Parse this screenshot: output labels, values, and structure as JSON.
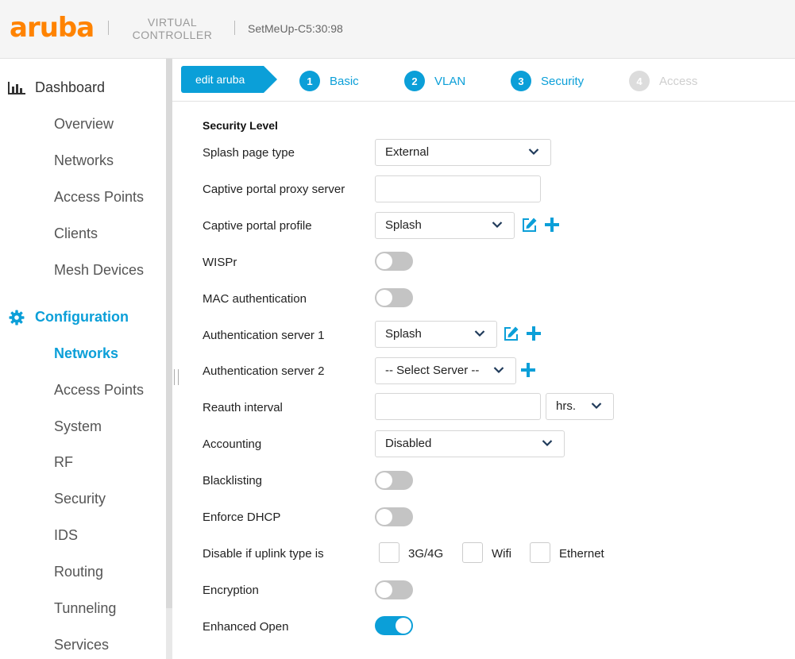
{
  "header": {
    "logo": "aruba",
    "product_line1": "VIRTUAL",
    "product_line2": "CONTROLLER",
    "device_name": "SetMeUp-C5:30:98"
  },
  "sidebar": {
    "dashboard": {
      "label": "Dashboard",
      "items": [
        "Overview",
        "Networks",
        "Access Points",
        "Clients",
        "Mesh Devices"
      ]
    },
    "configuration": {
      "label": "Configuration",
      "items": [
        "Networks",
        "Access Points",
        "System",
        "RF",
        "Security",
        "IDS",
        "Routing",
        "Tunneling",
        "Services"
      ],
      "active": "Networks"
    }
  },
  "wizard": {
    "edit_label": "edit aruba",
    "steps": [
      {
        "num": "1",
        "label": "Basic",
        "enabled": true
      },
      {
        "num": "2",
        "label": "VLAN",
        "enabled": true
      },
      {
        "num": "3",
        "label": "Security",
        "enabled": true
      },
      {
        "num": "4",
        "label": "Access",
        "enabled": false
      }
    ]
  },
  "form": {
    "title": "Security Level",
    "splash_page_type": {
      "label": "Splash page type",
      "value": "External"
    },
    "captive_proxy": {
      "label": "Captive portal proxy server",
      "value": ""
    },
    "captive_profile": {
      "label": "Captive portal profile",
      "value": "Splash"
    },
    "wispr": {
      "label": "WISPr",
      "on": false
    },
    "mac_auth": {
      "label": "MAC authentication",
      "on": false
    },
    "auth_server1": {
      "label": "Authentication server 1",
      "value": "Splash"
    },
    "auth_server2": {
      "label": "Authentication server 2",
      "value": "-- Select Server --"
    },
    "reauth": {
      "label": "Reauth interval",
      "value": "",
      "unit": "hrs."
    },
    "accounting": {
      "label": "Accounting",
      "value": "Disabled"
    },
    "blacklisting": {
      "label": "Blacklisting",
      "on": false
    },
    "enforce_dhcp": {
      "label": "Enforce DHCP",
      "on": false
    },
    "disable_uplink": {
      "label": "Disable if uplink type is",
      "options": [
        "3G/4G",
        "Wifi",
        "Ethernet"
      ]
    },
    "encryption": {
      "label": "Encryption",
      "on": false
    },
    "enhanced_open": {
      "label": "Enhanced Open",
      "on": true
    }
  },
  "colors": {
    "brand": "#ff8300",
    "accent": "#0b9fd8"
  }
}
